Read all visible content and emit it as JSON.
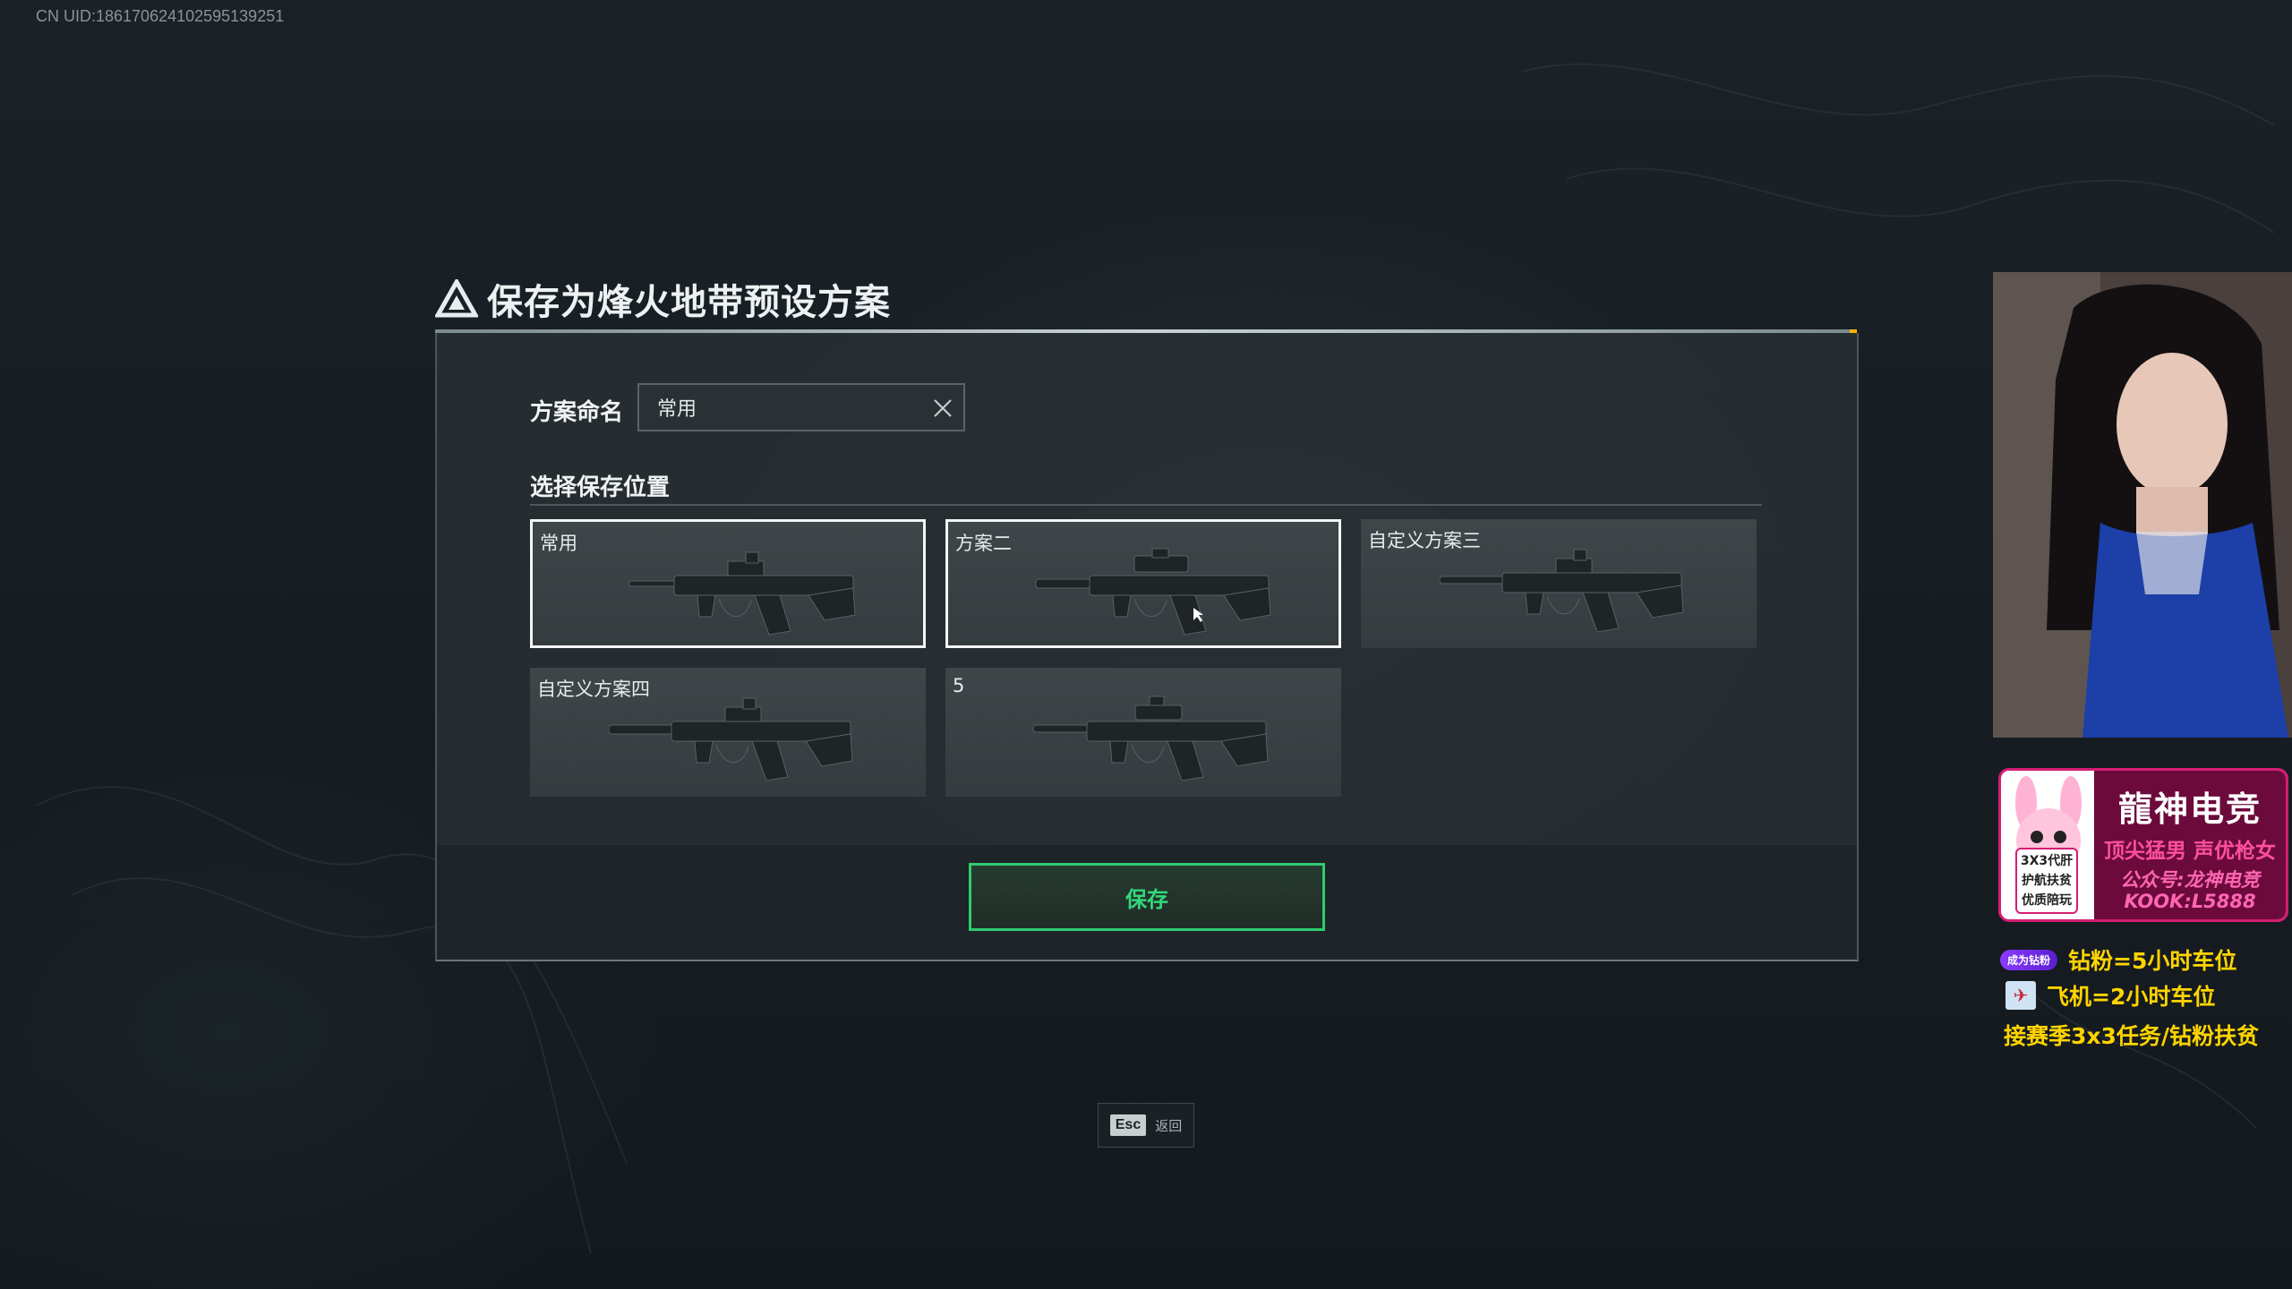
{
  "uid_text": "CN UID:1861706241025951392​51",
  "dialog": {
    "title": "保存为烽火地带预设方案",
    "name_label": "方案命名",
    "name_value": "常用",
    "location_label": "选择保存位置",
    "slots": [
      {
        "label": "常用",
        "selected": true
      },
      {
        "label": "方案二",
        "selected": true
      },
      {
        "label": "自定义方案三",
        "selected": false
      },
      {
        "label": "自定义方案四",
        "selected": false
      },
      {
        "label": "5",
        "selected": false
      }
    ],
    "save_label": "保存"
  },
  "esc_hint": {
    "key": "Esc",
    "text": "返回"
  },
  "stream_overlay": {
    "promo_title": "龍神电竞",
    "promo_slogan": "顶尖猛男 声优枪女",
    "promo_wechat": "公众号:龙神电竞",
    "promo_kook": "KOOK:L5888",
    "promo_services": [
      "3X3代肝",
      "护航扶贫",
      "优质陪玩"
    ],
    "perk_badge": "成为钻粉",
    "perks": [
      "钻粉=5小时车位",
      "飞机=2小时车位",
      "接赛季3x3任务/钻粉扶贫"
    ]
  },
  "colors": {
    "accent_green": "#2ecc71",
    "promo_pink": "#d51d73",
    "perk_yellow": "#ffd400"
  }
}
